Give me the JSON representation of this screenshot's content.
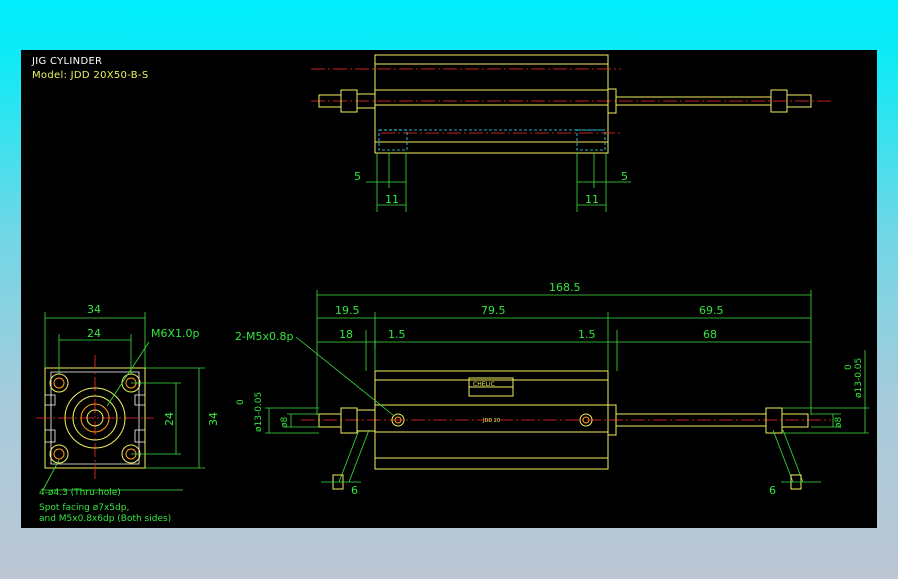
{
  "title": {
    "line1": "JIG CYLINDER",
    "line2": "Model:  JDD 20X50-B-S"
  },
  "top_view": {
    "dim_left_5": "5",
    "dim_left_11": "11",
    "dim_right_5": "5",
    "dim_right_11": "11"
  },
  "end_view": {
    "dim_34_top": "34",
    "dim_24_top": "24",
    "dim_24_side": "24",
    "dim_34_side": "34",
    "thread_label": "M6X1.0p",
    "hole_note": "4-ø4.3 (Thru-hole)",
    "spot_note_1": "Spot facing  ø7x5dp,",
    "spot_note_2": "and  M5x0.8x6dp (Both sides)"
  },
  "front_view": {
    "overall": "168.5",
    "d19_5": "19.5",
    "d79_5": "79.5",
    "d69_5": "69.5",
    "d18": "18",
    "d1_5_left": "1.5",
    "d1_5_right": "1.5",
    "d68": "68",
    "port_label": "2-M5x0.8p",
    "left_dia_tol": "0",
    "left_dia": "ø13-0.05",
    "left_dia8": "ø8",
    "right_dia_tol": "0",
    "right_dia": "ø13-0.05",
    "right_dia8": "ø8",
    "nut_left": "6",
    "nut_right": "6"
  },
  "colors": {
    "background": "#000000",
    "outline": "#f2ee5c",
    "dimension": "#33e640",
    "centerline": "#ff2a2a",
    "hidden": "#35e5ff"
  }
}
